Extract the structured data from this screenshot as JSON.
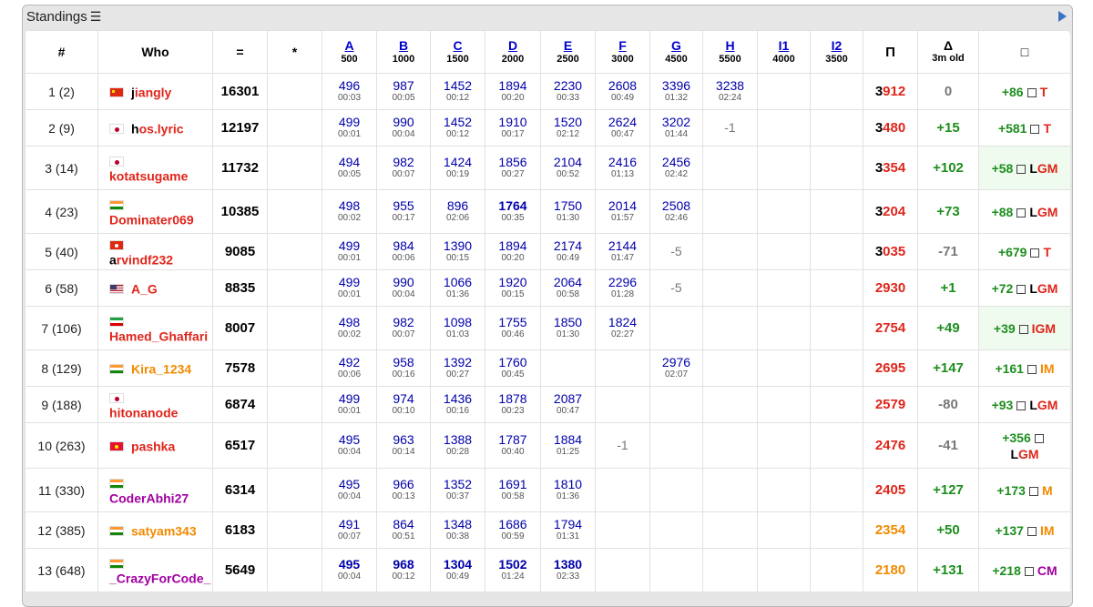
{
  "caption": {
    "title": "Standings",
    "list_icon": "list-icon",
    "collapse_icon": "triangle-right-icon"
  },
  "header": {
    "rank": "#",
    "who": "Who",
    "points": "=",
    "penalty": "*",
    "problems": [
      {
        "label": "A",
        "points": "500"
      },
      {
        "label": "B",
        "points": "1000"
      },
      {
        "label": "C",
        "points": "1500"
      },
      {
        "label": "D",
        "points": "2000"
      },
      {
        "label": "E",
        "points": "2500"
      },
      {
        "label": "F",
        "points": "3000"
      },
      {
        "label": "G",
        "points": "4500"
      },
      {
        "label": "H",
        "points": "5500"
      },
      {
        "label": "I1",
        "points": "4000"
      },
      {
        "label": "I2",
        "points": "3500"
      }
    ],
    "perf": "Π",
    "delta": "Δ",
    "delta_sub": "3m old",
    "rating_change": "□"
  },
  "rows": [
    {
      "rank": "1 (2)",
      "flag": "cn",
      "first": "j",
      "rest": "iangly",
      "first_color": "#000000",
      "rest_color": "#e0251b",
      "points": "16301",
      "cells": [
        [
          "496",
          "00:03"
        ],
        [
          "987",
          "00:05"
        ],
        [
          "1452",
          "00:12"
        ],
        [
          "1894",
          "00:20"
        ],
        [
          "2230",
          "00:33"
        ],
        [
          "2608",
          "00:49"
        ],
        [
          "3396",
          "01:32"
        ],
        [
          "3238",
          "02:24"
        ],
        [
          "",
          ""
        ],
        [
          "",
          ""
        ]
      ],
      "perf_first": "3",
      "perf_rest": "912",
      "perf_first_color": "#000000",
      "perf_color": "#e0251b",
      "delta": "0",
      "delta_color": "#777777",
      "change": "+86",
      "title": "T",
      "title_color": "#e0251b",
      "title_first": "",
      "hl": false
    },
    {
      "rank": "2 (9)",
      "flag": "jp",
      "first": "h",
      "rest": "os.lyric",
      "first_color": "#000000",
      "rest_color": "#e0251b",
      "points": "12197",
      "cells": [
        [
          "499",
          "00:01"
        ],
        [
          "990",
          "00:04"
        ],
        [
          "1452",
          "00:12"
        ],
        [
          "1910",
          "00:17"
        ],
        [
          "1520",
          "02:12"
        ],
        [
          "2624",
          "00:47"
        ],
        [
          "3202",
          "01:44"
        ],
        [
          "-1",
          ""
        ],
        [
          "",
          ""
        ],
        [
          "",
          ""
        ]
      ],
      "perf_first": "3",
      "perf_rest": "480",
      "perf_first_color": "#000000",
      "perf_color": "#e0251b",
      "delta": "+15",
      "delta_color": "#1e8e1e",
      "change": "+581",
      "title": "T",
      "title_color": "#e0251b",
      "title_first": "",
      "hl": false
    },
    {
      "rank": "3 (14)",
      "flag": "jp",
      "first": "k",
      "rest": "otatsugame",
      "first_color": "#e0251b",
      "rest_color": "#e0251b",
      "points": "11732",
      "cells": [
        [
          "494",
          "00:05"
        ],
        [
          "982",
          "00:07"
        ],
        [
          "1424",
          "00:19"
        ],
        [
          "1856",
          "00:27"
        ],
        [
          "2104",
          "00:52"
        ],
        [
          "2416",
          "01:13"
        ],
        [
          "2456",
          "02:42"
        ],
        [
          "",
          ""
        ],
        [
          "",
          ""
        ],
        [
          "",
          ""
        ]
      ],
      "perf_first": "3",
      "perf_rest": "354",
      "perf_first_color": "#000000",
      "perf_color": "#e0251b",
      "delta": "+102",
      "delta_color": "#1e8e1e",
      "change": "+58",
      "title": "GM",
      "title_color": "#e0251b",
      "title_first": "L",
      "hl": true
    },
    {
      "rank": "4 (23)",
      "flag": "in",
      "first": "D",
      "rest": "ominater069",
      "first_color": "#e0251b",
      "rest_color": "#e0251b",
      "points": "10385",
      "cells": [
        [
          "498",
          "00:02"
        ],
        [
          "955",
          "00:17"
        ],
        [
          "896",
          "02:06"
        ],
        [
          "1764",
          "00:35"
        ],
        [
          "1750",
          "01:30"
        ],
        [
          "2014",
          "01:57"
        ],
        [
          "2508",
          "02:46"
        ],
        [
          "",
          ""
        ],
        [
          "",
          ""
        ],
        [
          "",
          ""
        ]
      ],
      "perf_first": "3",
      "perf_rest": "204",
      "perf_first_color": "#000000",
      "perf_color": "#e0251b",
      "delta": "+73",
      "delta_color": "#1e8e1e",
      "change": "+88",
      "title": "GM",
      "title_color": "#e0251b",
      "title_first": "L",
      "hl": false
    },
    {
      "rank": "5 (40)",
      "flag": "hk",
      "first": "a",
      "rest": "rvindf232",
      "first_color": "#000000",
      "rest_color": "#e0251b",
      "points": "9085",
      "cells": [
        [
          "499",
          "00:01"
        ],
        [
          "984",
          "00:06"
        ],
        [
          "1390",
          "00:15"
        ],
        [
          "1894",
          "00:20"
        ],
        [
          "2174",
          "00:49"
        ],
        [
          "2144",
          "01:47"
        ],
        [
          "-5",
          ""
        ],
        [
          "",
          ""
        ],
        [
          "",
          ""
        ],
        [
          "",
          ""
        ]
      ],
      "perf_first": "3",
      "perf_rest": "035",
      "perf_first_color": "#000000",
      "perf_color": "#e0251b",
      "delta": "-71",
      "delta_color": "#777777",
      "change": "+679",
      "title": "T",
      "title_color": "#e0251b",
      "title_first": "",
      "hl": false
    },
    {
      "rank": "6 (58)",
      "flag": "us",
      "first": "A",
      "rest": "_G",
      "first_color": "#e0251b",
      "rest_color": "#e0251b",
      "points": "8835",
      "cells": [
        [
          "499",
          "00:01"
        ],
        [
          "990",
          "00:04"
        ],
        [
          "1066",
          "01:36"
        ],
        [
          "1920",
          "00:15"
        ],
        [
          "2064",
          "00:58"
        ],
        [
          "2296",
          "01:28"
        ],
        [
          "-5",
          ""
        ],
        [
          "",
          ""
        ],
        [
          "",
          ""
        ],
        [
          "",
          ""
        ]
      ],
      "perf_first": "",
      "perf_rest": "2930",
      "perf_first_color": "#e0251b",
      "perf_color": "#e0251b",
      "delta": "+1",
      "delta_color": "#1e8e1e",
      "change": "+72",
      "title": "GM",
      "title_color": "#e0251b",
      "title_first": "L",
      "hl": false
    },
    {
      "rank": "7 (106)",
      "flag": "ir",
      "first": "H",
      "rest": "amed_Ghaffari",
      "first_color": "#e0251b",
      "rest_color": "#e0251b",
      "points": "8007",
      "cells": [
        [
          "498",
          "00:02"
        ],
        [
          "982",
          "00:07"
        ],
        [
          "1098",
          "01:03"
        ],
        [
          "1755",
          "00:46"
        ],
        [
          "1850",
          "01:30"
        ],
        [
          "1824",
          "02:27"
        ],
        [
          "",
          ""
        ],
        [
          "",
          ""
        ],
        [
          "",
          ""
        ],
        [
          "",
          ""
        ]
      ],
      "perf_first": "",
      "perf_rest": "2754",
      "perf_first_color": "#e0251b",
      "perf_color": "#e0251b",
      "delta": "+49",
      "delta_color": "#1e8e1e",
      "change": "+39",
      "title": "IGM",
      "title_color": "#e0251b",
      "title_first": "",
      "hl": true
    },
    {
      "rank": "8 (129)",
      "flag": "in",
      "first": "K",
      "rest": "ira_1234",
      "first_color": "#f28a00",
      "rest_color": "#f28a00",
      "points": "7578",
      "cells": [
        [
          "492",
          "00:06"
        ],
        [
          "958",
          "00:16"
        ],
        [
          "1392",
          "00:27"
        ],
        [
          "1760",
          "00:45"
        ],
        [
          "",
          ""
        ],
        [
          "",
          ""
        ],
        [
          "2976",
          "02:07"
        ],
        [
          "",
          ""
        ],
        [
          "",
          ""
        ],
        [
          "",
          ""
        ]
      ],
      "perf_first": "",
      "perf_rest": "2695",
      "perf_first_color": "#e0251b",
      "perf_color": "#e0251b",
      "delta": "+147",
      "delta_color": "#1e8e1e",
      "change": "+161",
      "title": "IM",
      "title_color": "#f28a00",
      "title_first": "",
      "hl": false
    },
    {
      "rank": "9 (188)",
      "flag": "jp",
      "first": "h",
      "rest": "itonanode",
      "first_color": "#e0251b",
      "rest_color": "#e0251b",
      "points": "6874",
      "cells": [
        [
          "499",
          "00:01"
        ],
        [
          "974",
          "00:10"
        ],
        [
          "1436",
          "00:16"
        ],
        [
          "1878",
          "00:23"
        ],
        [
          "2087",
          "00:47"
        ],
        [
          "",
          ""
        ],
        [
          "",
          ""
        ],
        [
          "",
          ""
        ],
        [
          "",
          ""
        ],
        [
          "",
          ""
        ]
      ],
      "perf_first": "",
      "perf_rest": "2579",
      "perf_first_color": "#e0251b",
      "perf_color": "#e0251b",
      "delta": "-80",
      "delta_color": "#777777",
      "change": "+93",
      "title": "GM",
      "title_color": "#e0251b",
      "title_first": "L",
      "hl": false
    },
    {
      "rank": "10 (263)",
      "flag": "kg",
      "first": "p",
      "rest": "ashka",
      "first_color": "#e0251b",
      "rest_color": "#e0251b",
      "points": "6517",
      "cells": [
        [
          "495",
          "00:04"
        ],
        [
          "963",
          "00:14"
        ],
        [
          "1388",
          "00:28"
        ],
        [
          "1787",
          "00:40"
        ],
        [
          "1884",
          "01:25"
        ],
        [
          "-1",
          ""
        ],
        [
          "",
          ""
        ],
        [
          "",
          ""
        ],
        [
          "",
          ""
        ],
        [
          "",
          ""
        ]
      ],
      "perf_first": "",
      "perf_rest": "2476",
      "perf_first_color": "#e0251b",
      "perf_color": "#e0251b",
      "delta": "-41",
      "delta_color": "#777777",
      "change": "+356",
      "title": "GM",
      "title_color": "#e0251b",
      "title_first": "L",
      "hl": false,
      "wrap": true
    },
    {
      "rank": "11 (330)",
      "flag": "in",
      "first": "C",
      "rest": "oderAbhi27",
      "first_color": "#a100a1",
      "rest_color": "#a100a1",
      "points": "6314",
      "cells": [
        [
          "495",
          "00:04"
        ],
        [
          "966",
          "00:13"
        ],
        [
          "1352",
          "00:37"
        ],
        [
          "1691",
          "00:58"
        ],
        [
          "1810",
          "01:36"
        ],
        [
          "",
          ""
        ],
        [
          "",
          ""
        ],
        [
          "",
          ""
        ],
        [
          "",
          ""
        ],
        [
          "",
          ""
        ]
      ],
      "perf_first": "",
      "perf_rest": "2405",
      "perf_first_color": "#e0251b",
      "perf_color": "#e0251b",
      "delta": "+127",
      "delta_color": "#1e8e1e",
      "change": "+173",
      "title": "M",
      "title_color": "#f28a00",
      "title_first": "",
      "hl": false
    },
    {
      "rank": "12 (385)",
      "flag": "in",
      "first": "s",
      "rest": "atyam343",
      "first_color": "#f28a00",
      "rest_color": "#f28a00",
      "points": "6183",
      "cells": [
        [
          "491",
          "00:07"
        ],
        [
          "864",
          "00:51"
        ],
        [
          "1348",
          "00:38"
        ],
        [
          "1686",
          "00:59"
        ],
        [
          "1794",
          "01:31"
        ],
        [
          "",
          ""
        ],
        [
          "",
          ""
        ],
        [
          "",
          ""
        ],
        [
          "",
          ""
        ],
        [
          "",
          ""
        ]
      ],
      "perf_first": "",
      "perf_rest": "2354",
      "perf_first_color": "#f28a00",
      "perf_color": "#f28a00",
      "delta": "+50",
      "delta_color": "#1e8e1e",
      "change": "+137",
      "title": "IM",
      "title_color": "#f28a00",
      "title_first": "",
      "hl": false
    },
    {
      "rank": "13 (648)",
      "flag": "in",
      "first": "_",
      "rest": "CrazyForCode_",
      "first_color": "#a100a1",
      "rest_color": "#a100a1",
      "points": "5649",
      "cells": [
        [
          "495",
          "00:04"
        ],
        [
          "968",
          "00:12"
        ],
        [
          "1304",
          "00:49"
        ],
        [
          "1502",
          "01:24"
        ],
        [
          "1380",
          "02:33"
        ],
        [
          "",
          ""
        ],
        [
          "",
          ""
        ],
        [
          "",
          ""
        ],
        [
          "",
          ""
        ],
        [
          "",
          ""
        ]
      ],
      "perf_first": "",
      "perf_rest": "2180",
      "perf_first_color": "#f28a00",
      "perf_color": "#f28a00",
      "delta": "+131",
      "delta_color": "#1e8e1e",
      "change": "+218",
      "title": "CM",
      "title_color": "#a100a1",
      "title_first": "",
      "hl": false,
      "boldcells": true
    }
  ]
}
